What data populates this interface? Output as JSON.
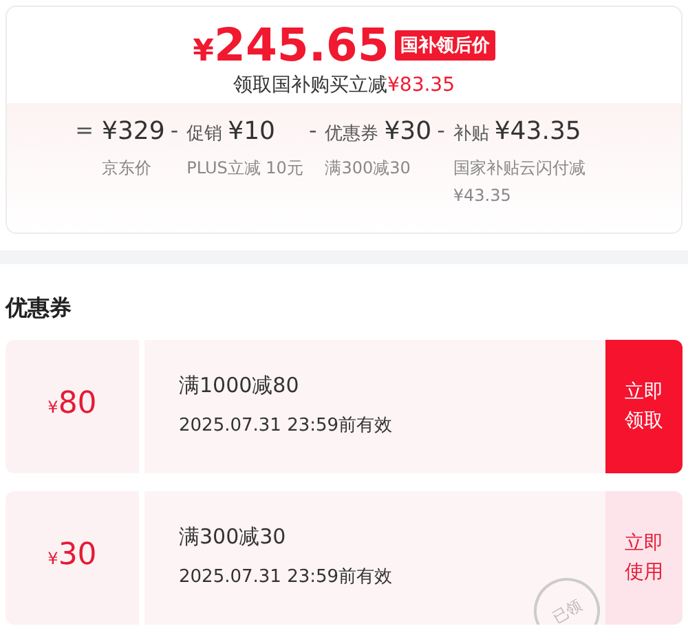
{
  "price_card": {
    "currency": "¥",
    "price": "245.65",
    "badge": "国补领后价",
    "saving_text": "领取国补购买立减",
    "saving_amount": "¥83.35",
    "breakdown": [
      {
        "op": "=",
        "amount": "¥329",
        "note": "京东价"
      },
      {
        "op": "-",
        "label": "促销",
        "amount": "¥10",
        "note": "PLUS立减 10元"
      },
      {
        "op": "-",
        "label": "优惠券",
        "amount": "¥30",
        "note": "满300减30"
      },
      {
        "op": "-",
        "label": "补贴",
        "amount": "¥43.35",
        "note": "国家补贴云闪付减¥43.35"
      }
    ]
  },
  "coupons_section": {
    "title": "优惠券",
    "coupons": [
      {
        "currency": "¥",
        "value": "80",
        "condition": "满1000减80",
        "validity": "2025.07.31 23:59前有效",
        "action": "立即领取",
        "claimed": false
      },
      {
        "currency": "¥",
        "value": "30",
        "condition": "满300减30",
        "validity": "2025.07.31 23:59前有效",
        "action": "立即使用",
        "claimed": true,
        "stamp": "已领"
      }
    ]
  }
}
